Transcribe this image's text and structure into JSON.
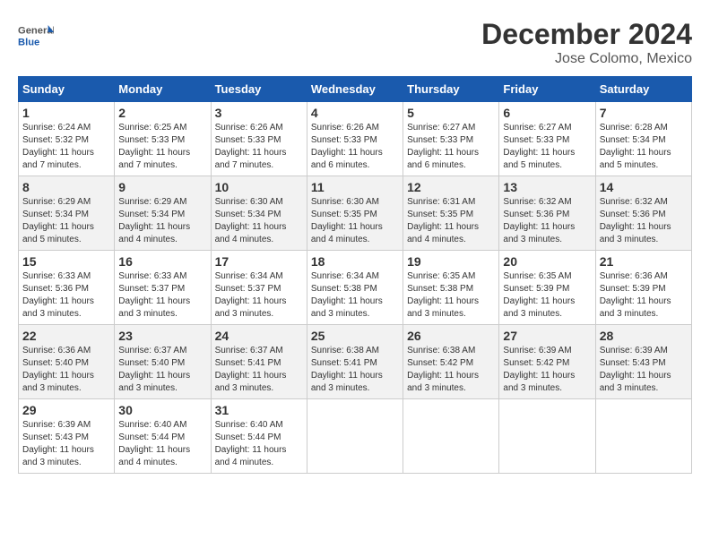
{
  "logo": {
    "text_general": "General",
    "text_blue": "Blue"
  },
  "header": {
    "title": "December 2024",
    "subtitle": "Jose Colomo, Mexico"
  },
  "calendar": {
    "days_of_week": [
      "Sunday",
      "Monday",
      "Tuesday",
      "Wednesday",
      "Thursday",
      "Friday",
      "Saturday"
    ],
    "weeks": [
      [
        {
          "day": "1",
          "sunrise": "6:24 AM",
          "sunset": "5:32 PM",
          "daylight": "11 hours and 7 minutes."
        },
        {
          "day": "2",
          "sunrise": "6:25 AM",
          "sunset": "5:33 PM",
          "daylight": "11 hours and 7 minutes."
        },
        {
          "day": "3",
          "sunrise": "6:26 AM",
          "sunset": "5:33 PM",
          "daylight": "11 hours and 7 minutes."
        },
        {
          "day": "4",
          "sunrise": "6:26 AM",
          "sunset": "5:33 PM",
          "daylight": "11 hours and 6 minutes."
        },
        {
          "day": "5",
          "sunrise": "6:27 AM",
          "sunset": "5:33 PM",
          "daylight": "11 hours and 6 minutes."
        },
        {
          "day": "6",
          "sunrise": "6:27 AM",
          "sunset": "5:33 PM",
          "daylight": "11 hours and 5 minutes."
        },
        {
          "day": "7",
          "sunrise": "6:28 AM",
          "sunset": "5:34 PM",
          "daylight": "11 hours and 5 minutes."
        }
      ],
      [
        {
          "day": "8",
          "sunrise": "6:29 AM",
          "sunset": "5:34 PM",
          "daylight": "11 hours and 5 minutes."
        },
        {
          "day": "9",
          "sunrise": "6:29 AM",
          "sunset": "5:34 PM",
          "daylight": "11 hours and 4 minutes."
        },
        {
          "day": "10",
          "sunrise": "6:30 AM",
          "sunset": "5:34 PM",
          "daylight": "11 hours and 4 minutes."
        },
        {
          "day": "11",
          "sunrise": "6:30 AM",
          "sunset": "5:35 PM",
          "daylight": "11 hours and 4 minutes."
        },
        {
          "day": "12",
          "sunrise": "6:31 AM",
          "sunset": "5:35 PM",
          "daylight": "11 hours and 4 minutes."
        },
        {
          "day": "13",
          "sunrise": "6:32 AM",
          "sunset": "5:36 PM",
          "daylight": "11 hours and 3 minutes."
        },
        {
          "day": "14",
          "sunrise": "6:32 AM",
          "sunset": "5:36 PM",
          "daylight": "11 hours and 3 minutes."
        }
      ],
      [
        {
          "day": "15",
          "sunrise": "6:33 AM",
          "sunset": "5:36 PM",
          "daylight": "11 hours and 3 minutes."
        },
        {
          "day": "16",
          "sunrise": "6:33 AM",
          "sunset": "5:37 PM",
          "daylight": "11 hours and 3 minutes."
        },
        {
          "day": "17",
          "sunrise": "6:34 AM",
          "sunset": "5:37 PM",
          "daylight": "11 hours and 3 minutes."
        },
        {
          "day": "18",
          "sunrise": "6:34 AM",
          "sunset": "5:38 PM",
          "daylight": "11 hours and 3 minutes."
        },
        {
          "day": "19",
          "sunrise": "6:35 AM",
          "sunset": "5:38 PM",
          "daylight": "11 hours and 3 minutes."
        },
        {
          "day": "20",
          "sunrise": "6:35 AM",
          "sunset": "5:39 PM",
          "daylight": "11 hours and 3 minutes."
        },
        {
          "day": "21",
          "sunrise": "6:36 AM",
          "sunset": "5:39 PM",
          "daylight": "11 hours and 3 minutes."
        }
      ],
      [
        {
          "day": "22",
          "sunrise": "6:36 AM",
          "sunset": "5:40 PM",
          "daylight": "11 hours and 3 minutes."
        },
        {
          "day": "23",
          "sunrise": "6:37 AM",
          "sunset": "5:40 PM",
          "daylight": "11 hours and 3 minutes."
        },
        {
          "day": "24",
          "sunrise": "6:37 AM",
          "sunset": "5:41 PM",
          "daylight": "11 hours and 3 minutes."
        },
        {
          "day": "25",
          "sunrise": "6:38 AM",
          "sunset": "5:41 PM",
          "daylight": "11 hours and 3 minutes."
        },
        {
          "day": "26",
          "sunrise": "6:38 AM",
          "sunset": "5:42 PM",
          "daylight": "11 hours and 3 minutes."
        },
        {
          "day": "27",
          "sunrise": "6:39 AM",
          "sunset": "5:42 PM",
          "daylight": "11 hours and 3 minutes."
        },
        {
          "day": "28",
          "sunrise": "6:39 AM",
          "sunset": "5:43 PM",
          "daylight": "11 hours and 3 minutes."
        }
      ],
      [
        {
          "day": "29",
          "sunrise": "6:39 AM",
          "sunset": "5:43 PM",
          "daylight": "11 hours and 3 minutes."
        },
        {
          "day": "30",
          "sunrise": "6:40 AM",
          "sunset": "5:44 PM",
          "daylight": "11 hours and 4 minutes."
        },
        {
          "day": "31",
          "sunrise": "6:40 AM",
          "sunset": "5:44 PM",
          "daylight": "11 hours and 4 minutes."
        },
        null,
        null,
        null,
        null
      ]
    ]
  }
}
